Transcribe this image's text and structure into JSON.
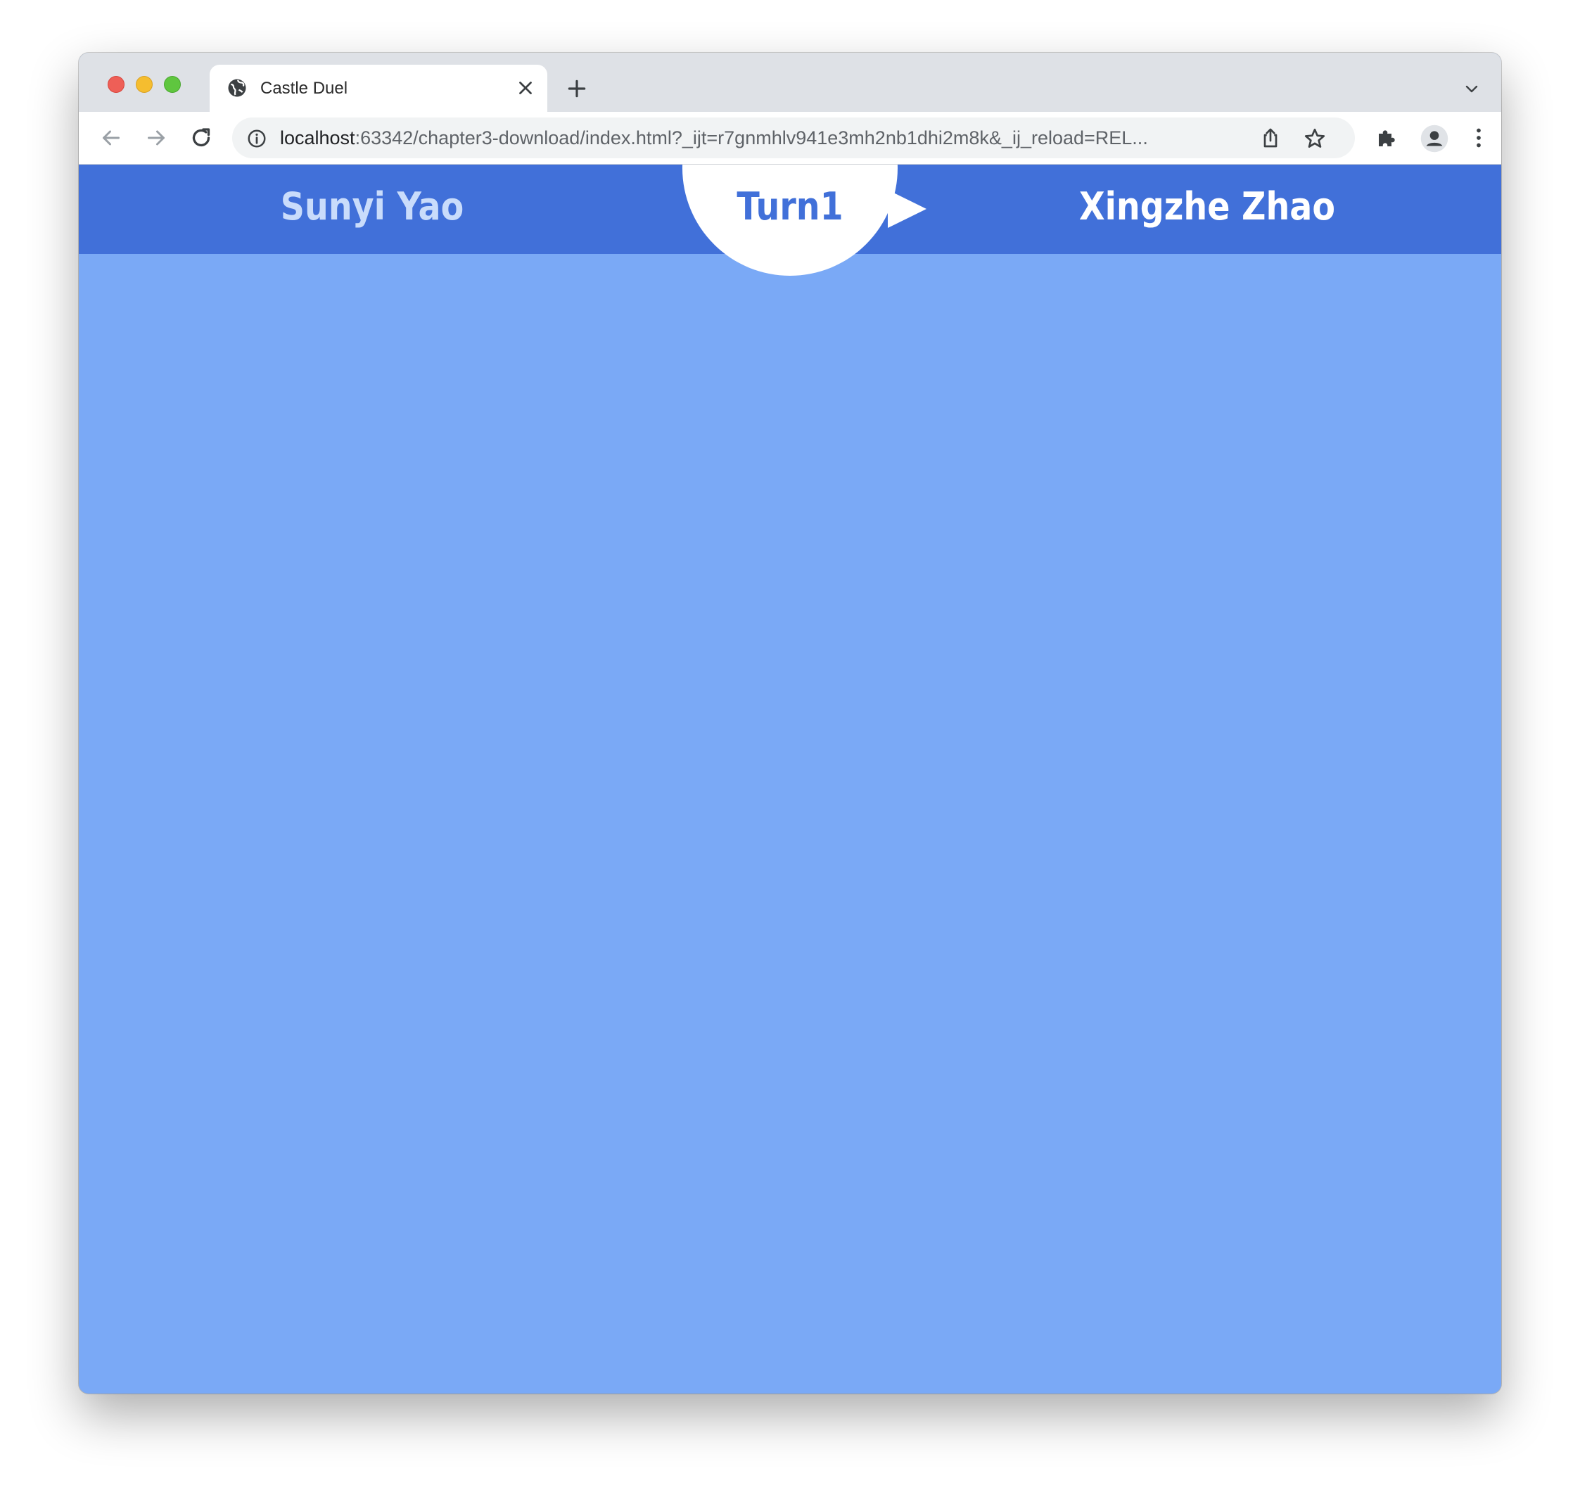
{
  "browser": {
    "tab": {
      "title": "Castle Duel",
      "icon": "globe-icon"
    },
    "address_bar": {
      "host": "localhost",
      "path": ":63342/chapter3-download/index.html?_ijt=r7gnmhlv941e3mh2nb1dhi2m8k&_ij_reload=REL..."
    },
    "icons": {
      "back": "arrow-left-icon",
      "forward": "arrow-right-icon",
      "reload": "reload-icon",
      "info": "info-icon",
      "share": "share-icon",
      "bookmark": "star-icon",
      "extensions": "puzzle-icon",
      "profile": "person-icon",
      "menu": "kebab-menu-icon"
    }
  },
  "game": {
    "player_left": "Sunyi Yao",
    "player_right": "Xingzhe Zhao",
    "turn_label": "Turn1",
    "colors": {
      "top_bar": "#4170d9",
      "background": "#7aa9f6",
      "inactive_player": "#c9dcfb",
      "active_player": "#ffffff",
      "turn_text": "#4170d9"
    },
    "turn_arrow_points_to": "right"
  }
}
